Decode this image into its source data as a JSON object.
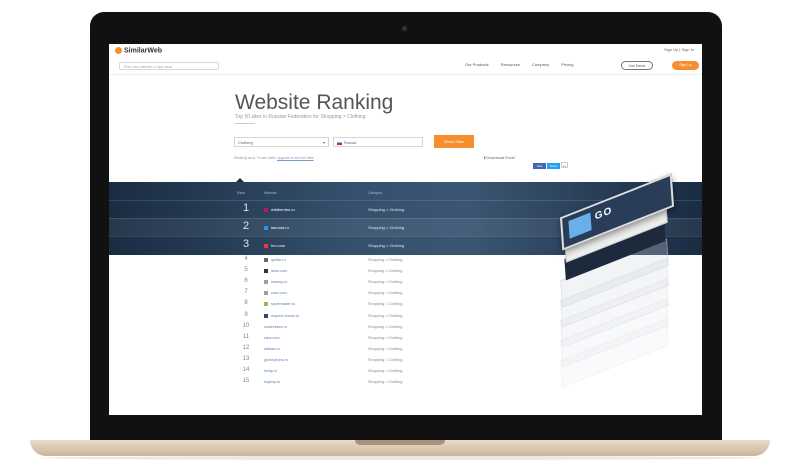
{
  "header": {
    "logo": "SimilarWeb",
    "top_links": "Sign Up | Sign In",
    "search_placeholder": "Enter any website or app name",
    "nav": [
      "Our Products",
      "Resources",
      "Company",
      "Pricing"
    ],
    "live_demo": "Live Demo",
    "cta": "Sign Up"
  },
  "page": {
    "title": "Website Ranking",
    "subtitle": "Top 50 sites in Russian Federation for Shopping > Clothing",
    "category_select": "Clothing",
    "country_select": "Russia",
    "search_button": "Show Sites",
    "notice": "Ranking as is. To see data:",
    "notice_link": "upgrade to see full data",
    "download": "Download Excel",
    "share": [
      "Like",
      "Tweet"
    ],
    "share_count": "0+"
  },
  "table": {
    "headers": {
      "rank": "Rank",
      "website": "Website",
      "category": "Category"
    },
    "highlight_rows": [
      {
        "rank": "1",
        "site": "wildberries.ru",
        "category": "Shopping > Clothing",
        "color": "#c2185b"
      },
      {
        "rank": "2",
        "site": "lamoda.ru",
        "category": "Shopping > Clothing",
        "color": "#2196f3"
      },
      {
        "rank": "3",
        "site": "hm.com",
        "category": "Shopping > Clothing",
        "color": "#e53935"
      }
    ],
    "rows": [
      {
        "rank": "4",
        "site": "quelle.ru",
        "category": "Shopping > Clothing",
        "color": "#546e7a"
      },
      {
        "rank": "5",
        "site": "asos.com",
        "category": "Shopping > Clothing",
        "color": "#333333"
      },
      {
        "rank": "6",
        "site": "mamsy.ru",
        "category": "Shopping > Clothing",
        "color": "#90a4ae"
      },
      {
        "rank": "7",
        "site": "zara.com",
        "category": "Shopping > Clothing",
        "color": "#9e9e9e"
      },
      {
        "rank": "8",
        "site": "sportmaster.ru",
        "category": "Shopping > Clothing",
        "color": "#8bc34a"
      },
      {
        "rank": "9",
        "site": "respect-shoes.ru",
        "category": "Shopping > Clothing",
        "color": "#37474f"
      },
      {
        "rank": "10",
        "site": "rusdresses.ru",
        "category": "Shopping > Clothing",
        "color": ""
      },
      {
        "rank": "11",
        "site": "zara.com",
        "category": "Shopping > Clothing",
        "color": ""
      },
      {
        "rank": "12",
        "site": "adidas.ru",
        "category": "Shopping > Clothing",
        "color": ""
      },
      {
        "rank": "13",
        "site": "gloria-jeans.ru",
        "category": "Shopping > Clothing",
        "color": ""
      },
      {
        "rank": "14",
        "site": "incity.ru",
        "category": "Shopping > Clothing",
        "color": ""
      },
      {
        "rank": "15",
        "site": "kupivip.ru",
        "category": "Shopping > Clothing",
        "color": ""
      }
    ]
  },
  "colors": {
    "accent": "#f68d2e",
    "band": "#2c4460"
  }
}
